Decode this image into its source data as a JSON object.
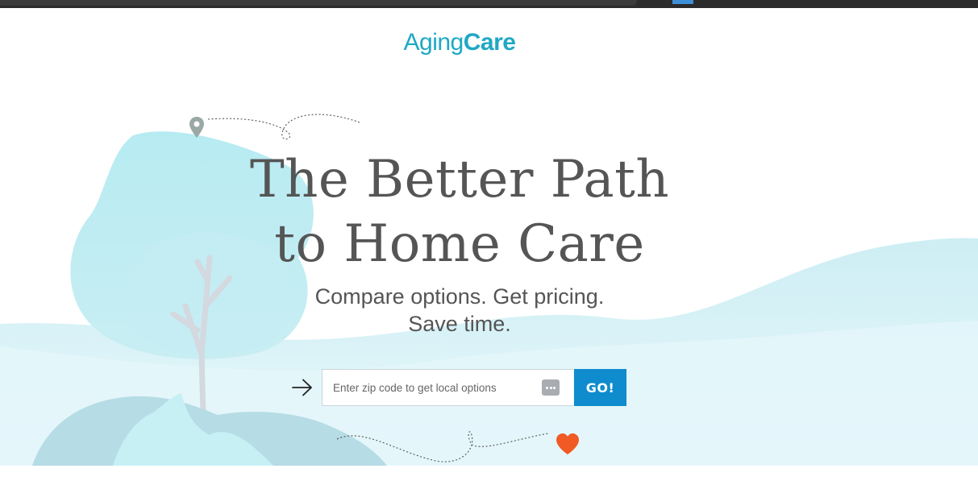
{
  "logo": {
    "part1": "Aging",
    "part2": "Care"
  },
  "hero": {
    "headline_line1": "The Better Path",
    "headline_line2": "to Home Care",
    "subhead_line1": "Compare options. Get pricing.",
    "subhead_line2": "Save time."
  },
  "search": {
    "value": "",
    "placeholder": "Enter zip code to get local options",
    "button_label": "GO!"
  },
  "icons": {
    "pin": "map-pin-icon",
    "arrow": "arrow-right-icon",
    "autofill": "autofill-icon",
    "heart": "heart-icon"
  },
  "colors": {
    "brand": "#1fa8c5",
    "go_button": "#0f8ccd",
    "heart": "#f15a24",
    "text": "#555555",
    "landscape_light": "#d8f1f6",
    "tree_canopy": "#bdebf2"
  }
}
